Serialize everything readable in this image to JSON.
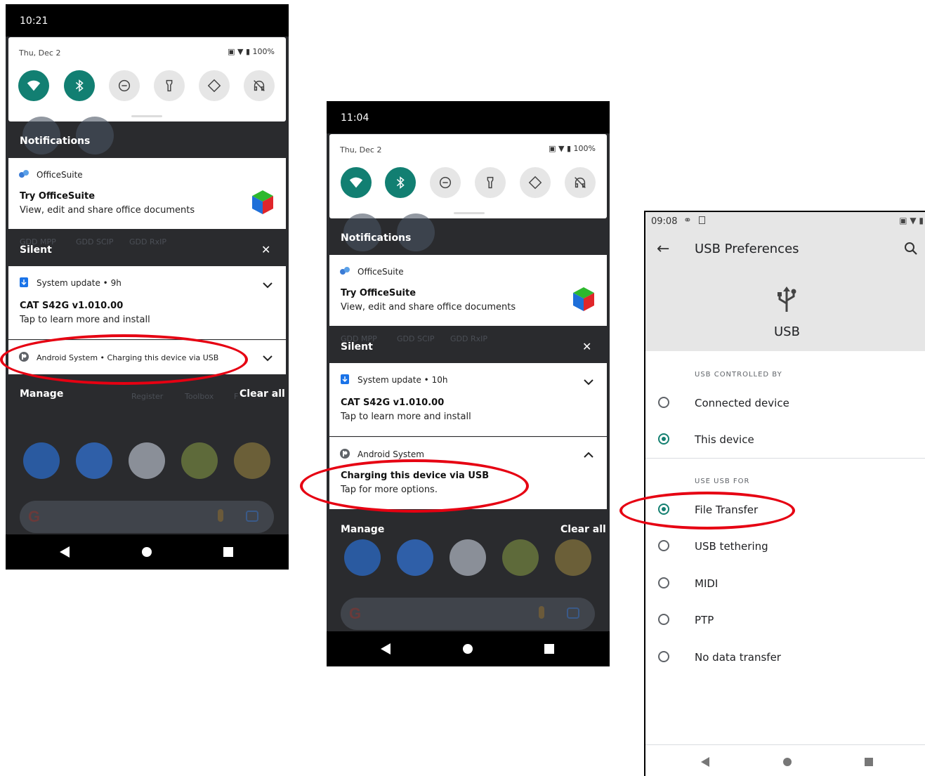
{
  "phone1": {
    "time": "10:21",
    "date": "Thu, Dec 2",
    "battery": "100%",
    "notifications_label": "Notifications",
    "office_app": "OfficeSuite",
    "office_title": "Try OfficeSuite",
    "office_text": "View, edit and share office documents",
    "ghost_labels": [
      "GDD MPP",
      "GDD SCIP",
      "GDD RxIP"
    ],
    "silent_label": "Silent",
    "sysupdate_app": "System update",
    "sysupdate_time": "9h",
    "sysupdate_title": "CAT S42G v1.010.00",
    "sysupdate_text": "Tap to learn more and install",
    "android_app": "Android System",
    "android_text": "Charging this device via USB",
    "manage_label": "Manage",
    "clear_label": "Clear all",
    "ghost_labels2": [
      "Register",
      "Toolbox",
      "F"
    ]
  },
  "phone2": {
    "time": "11:04",
    "date": "Thu, Dec 2",
    "battery": "100%",
    "notifications_label": "Notifications",
    "office_app": "OfficeSuite",
    "office_title": "Try OfficeSuite",
    "office_text": "View, edit and share office documents",
    "ghost_labels": [
      "GDD MPP",
      "GDD SCIP",
      "GDD RxIP"
    ],
    "silent_label": "Silent",
    "sysupdate_app": "System update",
    "sysupdate_time": "10h",
    "sysupdate_title": "CAT S42G v1.010.00",
    "sysupdate_text": "Tap to learn more and install",
    "android_app": "Android System",
    "android_title": "Charging this device via USB",
    "android_text": "Tap for more options.",
    "manage_label": "Manage",
    "clear_label": "Clear all"
  },
  "settings": {
    "time": "09:08",
    "title": "USB Preferences",
    "usb_label": "USB",
    "controlled_by_header": "USB CONTROLLED BY",
    "controlled_options": [
      {
        "label": "Connected device",
        "checked": false
      },
      {
        "label": "This device",
        "checked": true
      }
    ],
    "use_for_header": "USE USB FOR",
    "use_options": [
      {
        "label": "File Transfer",
        "checked": true
      },
      {
        "label": "USB tethering",
        "checked": false
      },
      {
        "label": "MIDI",
        "checked": false
      },
      {
        "label": "PTP",
        "checked": false
      },
      {
        "label": "No data transfer",
        "checked": false
      }
    ]
  },
  "colors": {
    "accent": "#127f72",
    "highlight": "#e60012",
    "shade": "#2a2b2e"
  }
}
